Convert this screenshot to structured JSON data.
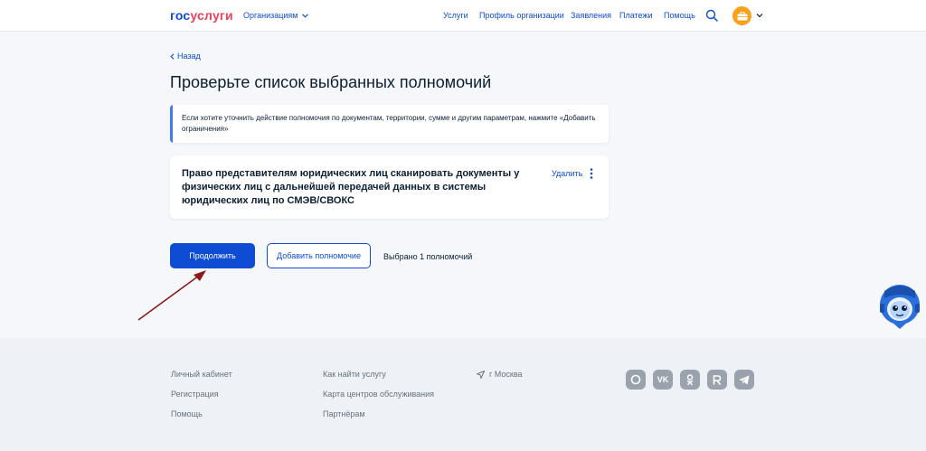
{
  "header": {
    "logo_part1": "гос",
    "logo_part2": "услуги",
    "org_menu": "Организациям",
    "nav": [
      "Услуги",
      "Профиль организации",
      "Заявления",
      "Платежи",
      "Помощь"
    ]
  },
  "main": {
    "back": "Назад",
    "title": "Проверьте список выбранных полномочий",
    "info_text": "Если хотите уточнить действие полномочия по документам, территории, сумме и другим параметрам, нажмите «Добавить ограничения»",
    "permission": {
      "text": "Право представителям юридических лиц сканировать документы у физических лиц с дальнейшей передачей данных в системы юридических лиц по СМЭВ/СВОКС",
      "remove_label": "Удалить"
    },
    "continue_button": "Продолжить",
    "add_button": "Добавить полномочие",
    "selected_count": "Выбрано 1 полномочий"
  },
  "footer": {
    "col1": [
      "Личный кабинет",
      "Регистрация",
      "Помощь"
    ],
    "col2": [
      "Как найти услугу",
      "Карта центров обслуживания",
      "Партнёрам"
    ],
    "city": "г Москва",
    "socials": [
      "max-icon",
      "vk-icon",
      "odnoklassniki-icon",
      "rutube-icon",
      "telegram-icon"
    ]
  },
  "colors": {
    "brand_blue": "#0d4cd3",
    "brand_red": "#ee3f58",
    "annotation_arrow": "#8b1a1a"
  }
}
